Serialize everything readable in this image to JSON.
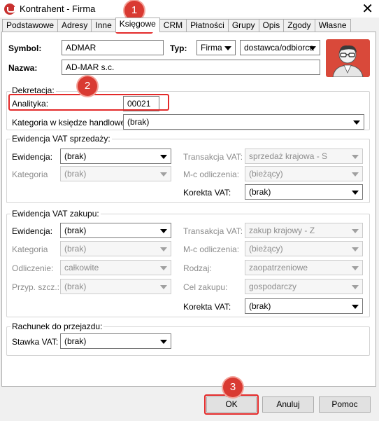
{
  "window": {
    "title": "Kontrahent - Firma"
  },
  "tabs": [
    {
      "label": "Podstawowe"
    },
    {
      "label": "Adresy"
    },
    {
      "label": "Inne"
    },
    {
      "label": "Księgowe"
    },
    {
      "label": "CRM"
    },
    {
      "label": "Płatności"
    },
    {
      "label": "Grupy"
    },
    {
      "label": "Opis"
    },
    {
      "label": "Zgody"
    },
    {
      "label": "Własne"
    }
  ],
  "header": {
    "symbol_label": "Symbol:",
    "symbol_value": "ADMAR",
    "typ_label": "Typ:",
    "typ_value": "Firma",
    "typ2_value": "dostawca/odbiorca",
    "nazwa_label": "Nazwa:",
    "nazwa_value": "AD-MAR s.c."
  },
  "dekretacja": {
    "title": "Dekretacja:",
    "analityka_label": "Analityka:",
    "analityka_value": "00021",
    "kategoria_label": "Kategoria w księdze handlowej:",
    "kategoria_value": "(brak)"
  },
  "vat_sprzedazy": {
    "title": "Ewidencja VAT sprzedaży:",
    "ewidencja_label": "Ewidencja:",
    "ewidencja_value": "(brak)",
    "kategoria_label": "Kategoria",
    "kategoria_value": "(brak)",
    "transakcja_label": "Transakcja VAT:",
    "transakcja_value": "sprzedaż krajowa - S",
    "mc_label": "M-c odliczenia:",
    "mc_value": "(bieżący)",
    "korekta_label": "Korekta VAT:",
    "korekta_value": "(brak)"
  },
  "vat_zakupu": {
    "title": "Ewidencja VAT zakupu:",
    "ewidencja_label": "Ewidencja:",
    "ewidencja_value": "(brak)",
    "kategoria_label": "Kategoria",
    "kategoria_value": "(brak)",
    "odliczenie_label": "Odliczenie:",
    "odliczenie_value": "całkowite",
    "przyp_label": "Przyp. szcz.:",
    "przyp_value": "(brak)",
    "transakcja_label": "Transakcja VAT:",
    "transakcja_value": "zakup krajowy - Z",
    "mc_label": "M-c odliczenia:",
    "mc_value": "(bieżący)",
    "rodzaj_label": "Rodzaj:",
    "rodzaj_value": "zaopatrzeniowe",
    "cel_label": "Cel zakupu:",
    "cel_value": "gospodarczy",
    "korekta_label": "Korekta VAT:",
    "korekta_value": "(brak)"
  },
  "rachunek": {
    "title": "Rachunek do przejazdu:",
    "stawka_label": "Stawka VAT:",
    "stawka_value": "(brak)"
  },
  "buttons": {
    "ok": "OK",
    "cancel": "Anuluj",
    "help": "Pomoc"
  },
  "annotations": {
    "step1": "1",
    "step2": "2",
    "step3": "3"
  },
  "colors": {
    "highlight": "#e32a2a",
    "badge": "#d93a32",
    "avatar_bg": "#d9493a"
  }
}
